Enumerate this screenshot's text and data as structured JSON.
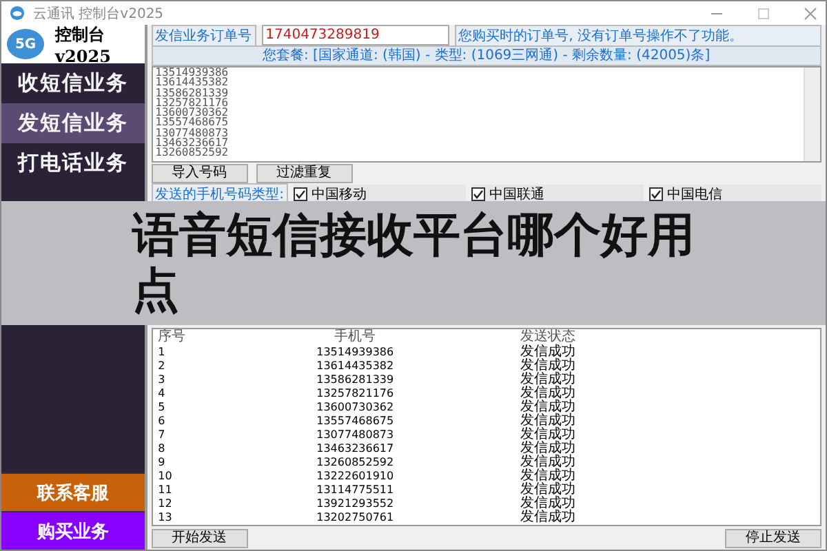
{
  "window": {
    "title": "云通讯 控制台v2025"
  },
  "sidebar": {
    "logo_badge": "5G",
    "logo_text": "控制台v2025",
    "items": [
      {
        "label": "收短信业务",
        "selected": false
      },
      {
        "label": "发短信业务",
        "selected": true
      },
      {
        "label": "打电话业务",
        "selected": false
      }
    ],
    "bottom_items": [
      {
        "label": "联系客服",
        "color": "#c8620a"
      },
      {
        "label": "购买业务",
        "color": "#8800ff"
      }
    ]
  },
  "order": {
    "label": "发信业务订单号",
    "value": "1740473289819",
    "hint": "您购买时的订单号, 没有订单号操作不了功能。"
  },
  "package_line": "您套餐: [国家通道: (韩国) - 类型: (1069三网通) - 剩余数量: (42005)条]",
  "numbers": [
    "13514939386",
    "13614435382",
    "13586281339",
    "13257821176",
    "13600730362",
    "13557468675",
    "13077480873",
    "13463236617",
    "13260852592"
  ],
  "number_buttons": [
    "导入号码",
    "过滤重复"
  ],
  "carrier_filter": {
    "label": "发送的手机号码类型:",
    "options": [
      {
        "label": "中国移动",
        "checked": true
      },
      {
        "label": "中国联通",
        "checked": true
      },
      {
        "label": "中国电信",
        "checked": true
      }
    ]
  },
  "table": {
    "columns": [
      "序号",
      "手机号",
      "发送状态"
    ],
    "rows": [
      [
        "1",
        "13514939386",
        "发信成功"
      ],
      [
        "2",
        "13614435382",
        "发信成功"
      ],
      [
        "3",
        "13586281339",
        "发信成功"
      ],
      [
        "4",
        "13257821176",
        "发信成功"
      ],
      [
        "5",
        "13600730362",
        "发信成功"
      ],
      [
        "6",
        "13557468675",
        "发信成功"
      ],
      [
        "7",
        "13077480873",
        "发信成功"
      ],
      [
        "8",
        "13463236617",
        "发信成功"
      ],
      [
        "9",
        "13260852592",
        "发信成功"
      ],
      [
        "10",
        "13222601910",
        "发信成功"
      ],
      [
        "11",
        "13114775511",
        "发信成功"
      ],
      [
        "12",
        "13921293552",
        "发信成功"
      ],
      [
        "13",
        "13202750761",
        "发信成功"
      ]
    ]
  },
  "actions": [
    "开始发送",
    "停止发送"
  ],
  "overlay_title": "语音短信接收平台哪个好用点"
}
